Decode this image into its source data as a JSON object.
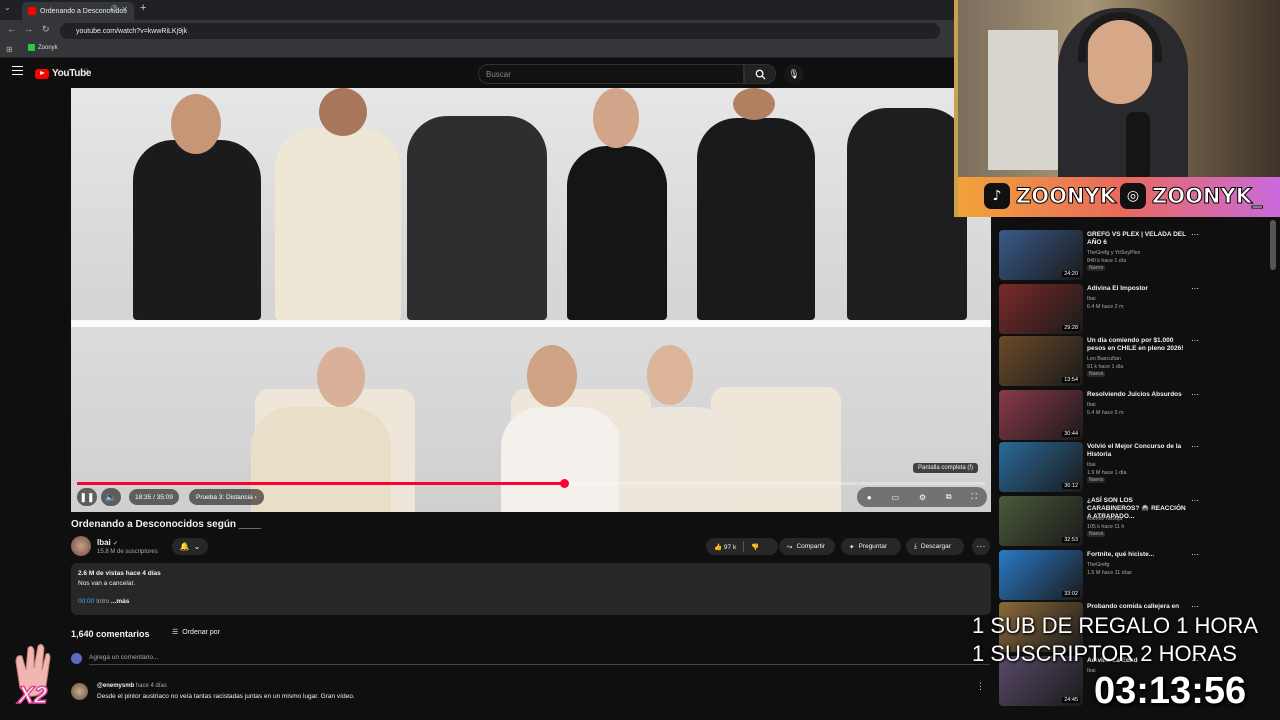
{
  "browser": {
    "tab_title": "Ordenando a Desconocidos",
    "url": "youtube.com/watch?v=kwwRiLKj9jk",
    "bookmark": "Zoonyk"
  },
  "youtube": {
    "logo_text": "YouTube",
    "logo_country": "CL",
    "search_placeholder": "Buscar"
  },
  "player": {
    "progress_fraction": 0.5366,
    "time": "18:35 / 35:09",
    "chapter": "Prueba 3: Distancia",
    "tooltip": "Pantalla completa (f)"
  },
  "video": {
    "title": "Ordenando a Desconocidos según ____",
    "channel": "Ibai",
    "subscribers": "15.8 M de suscriptores",
    "likes": "97 k",
    "share": "Compartir",
    "ask": "Preguntar",
    "download": "Descargar"
  },
  "description": {
    "stats": "2.6 M de vistas  hace 4 días",
    "text": "Nos van a cancelar.",
    "chapter_time": "00:00",
    "chapter_label": "Intro",
    "more": "...más"
  },
  "comments": {
    "count": "1,640 comentarios",
    "sort_label": "Ordenar por",
    "add_placeholder": "Agrega un comentario...",
    "first": {
      "user": "@enemysmb",
      "time": "hace 4 días",
      "text": "Desde el pintor austriaco no veía tantas racistadas juntas en un mismo lugar. Gran vídeo."
    }
  },
  "sidebar": {
    "items": [
      {
        "title": "GREFG VS PLEX | VELADA DEL AÑO 6",
        "channel": "TheGrefg y YoSoyPlex",
        "meta": "840 k  hace 1 día",
        "badge": "Nuevo",
        "duration": "24:20",
        "thumb": "#3a5a8a"
      },
      {
        "title": "Adivina El Impostor",
        "channel": "Ibai",
        "meta": "6.4 M  hace 2 m",
        "badge": "",
        "duration": "29:28",
        "thumb": "#7a2a2a"
      },
      {
        "title": "Un día comiendo por $1.000 pesos en CHILE en pleno 2026!",
        "channel": "Leo Bascuñan",
        "meta": "91 k  hace 1 día",
        "badge": "Nuevo",
        "duration": "13:54",
        "thumb": "#6a4a2a"
      },
      {
        "title": "Resolviendo Juicios Absurdos",
        "channel": "Ibai",
        "meta": "5.4 M  hace 5 m",
        "badge": "",
        "duration": "30:44",
        "thumb": "#8a3a4a"
      },
      {
        "title": "Volvió el Mejor Concurso de la Historia",
        "channel": "Ibai",
        "meta": "1.9 M  hace 1 día",
        "badge": "Nuevo",
        "duration": "36:12",
        "thumb": "#2a6a9a"
      },
      {
        "title": "¿ASÍ SON LOS CARABINEROS? 🚔 REACCIÓN A ATRAPADO...",
        "channel": "Markito Navaja",
        "meta": "105 k  hace 11 h",
        "badge": "Nuevo",
        "duration": "32:53",
        "thumb": "#4a5a3a"
      },
      {
        "title": "Fortnite, qué hiciste...",
        "channel": "TheGrefg",
        "meta": "1.5 M  hace 11 días",
        "badge": "",
        "duration": "33:02",
        "thumb": "#2a7ac8"
      },
      {
        "title": "Probando comida callejera en",
        "channel": "",
        "meta": "",
        "badge": "",
        "duration": "",
        "thumb": "#8a6a3a"
      },
      {
        "title": "Adivina La Edad",
        "channel": "Ibai",
        "meta": "",
        "badge": "",
        "duration": "24:45",
        "thumb": "#5a4a6a"
      }
    ]
  },
  "overlay": {
    "tiktok": "ZOONYK",
    "instagram": "ZOONYK_",
    "sub_line1": "1 SUB DE REGALO 1 HORA",
    "sub_line2": "1 SUSCRIPTOR 2 HORAS",
    "timer": "03:13:56",
    "multiplier": "X2"
  }
}
